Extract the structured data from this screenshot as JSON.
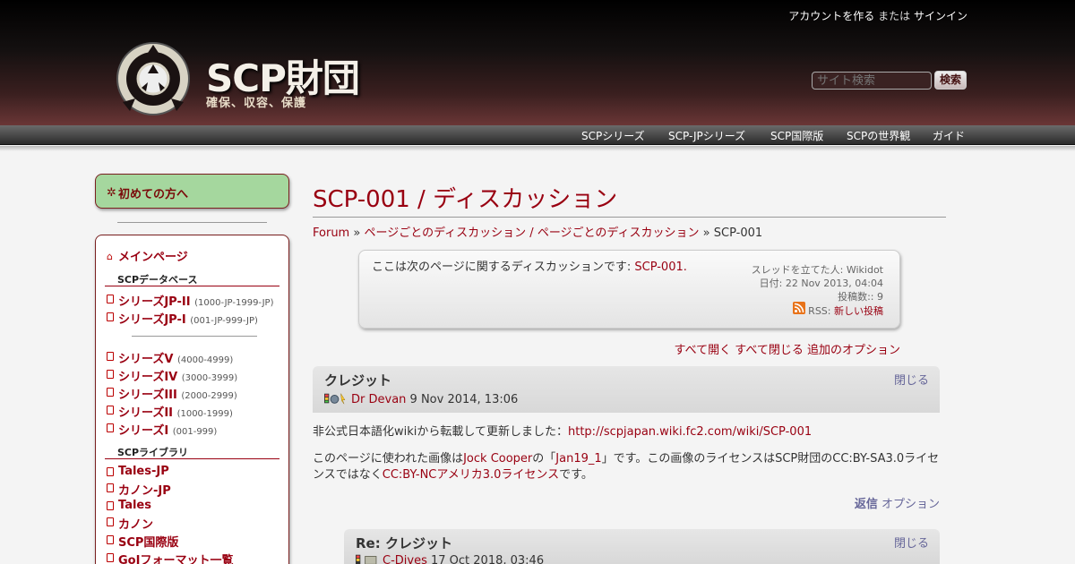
{
  "header": {
    "account_create": "アカウントを作る",
    "account_or": "または",
    "account_signin": "サインイン",
    "site_title": "SCP財団",
    "site_slogan": "確保、収容、保護",
    "search_placeholder": "サイト検索",
    "search_button": "検索"
  },
  "topnav": [
    "SCPシリーズ",
    "SCP-JPシリーズ",
    "SCP国際版",
    "SCPの世界観",
    "ガイド"
  ],
  "sidebar": {
    "first_time": "初めての方へ",
    "main_page": "メインページ",
    "heading_db": "SCPデータベース",
    "jp_series": [
      {
        "label": "シリーズJP-II",
        "range": "(1000-JP-1999-JP)"
      },
      {
        "label": "シリーズJP-I",
        "range": "(001-JP-999-JP)"
      }
    ],
    "series": [
      {
        "label": "シリーズV",
        "range": "(4000-4999)"
      },
      {
        "label": "シリーズIV",
        "range": "(3000-3999)"
      },
      {
        "label": "シリーズIII",
        "range": "(2000-2999)"
      },
      {
        "label": "シリーズII",
        "range": "(1000-1999)"
      },
      {
        "label": "シリーズI",
        "range": "(001-999)"
      }
    ],
    "heading_lib": "SCPライブラリ",
    "library": [
      "Tales-JP",
      "カノン-JP",
      "Tales",
      "カノン",
      "SCP国際版",
      "GoIフォーマット一覧"
    ]
  },
  "main": {
    "page_title": "SCP-001 / ディスカッション",
    "breadcrumb": {
      "forum": "Forum",
      "sep": "»",
      "category": "ページごとのディスカッション / ページごとのディスカッション",
      "current": "SCP-001"
    },
    "description": {
      "text": "ここは次のページに関するディスカッションです:",
      "link": "SCP-001.",
      "started_by": "スレッドを立てた人: Wikidot",
      "date": "日付: 22 Nov 2013, 04:04",
      "posts": "投稿数:: 9",
      "rss_label": "RSS:",
      "rss_link": "新しい投稿"
    },
    "thread_options": {
      "expand": "すべて開く",
      "collapse": "すべて閉じる",
      "more": "追加のオプション"
    },
    "posts": [
      {
        "title": "クレジット",
        "author": "Dr Devan",
        "date": "9 Nov 2014, 13:06",
        "close": "閉じる",
        "body1_text": "非公式日本語化wikiから転載して更新しました：",
        "body1_link": "http://scpjapan.wiki.fc2.com/wiki/SCP-001",
        "body2_a": "このページに使われた画像は",
        "body2_link1": "Jock Cooper",
        "body2_b": "の「",
        "body2_link2": "Jan19_1",
        "body2_c": "」です。この画像のライセンスはSCP財団のCC:BY-SA3.0ライセ",
        "body2_d": "ンスではなく",
        "body2_link3": "CC:BY-NCアメリカ3.0ライセンス",
        "body2_e": "です。",
        "reply": "返信",
        "options": "オプション"
      },
      {
        "title": "Re: クレジット",
        "author": "C-Dives",
        "date": "17 Oct 2018, 03:46",
        "close": "閉じる"
      }
    ]
  }
}
